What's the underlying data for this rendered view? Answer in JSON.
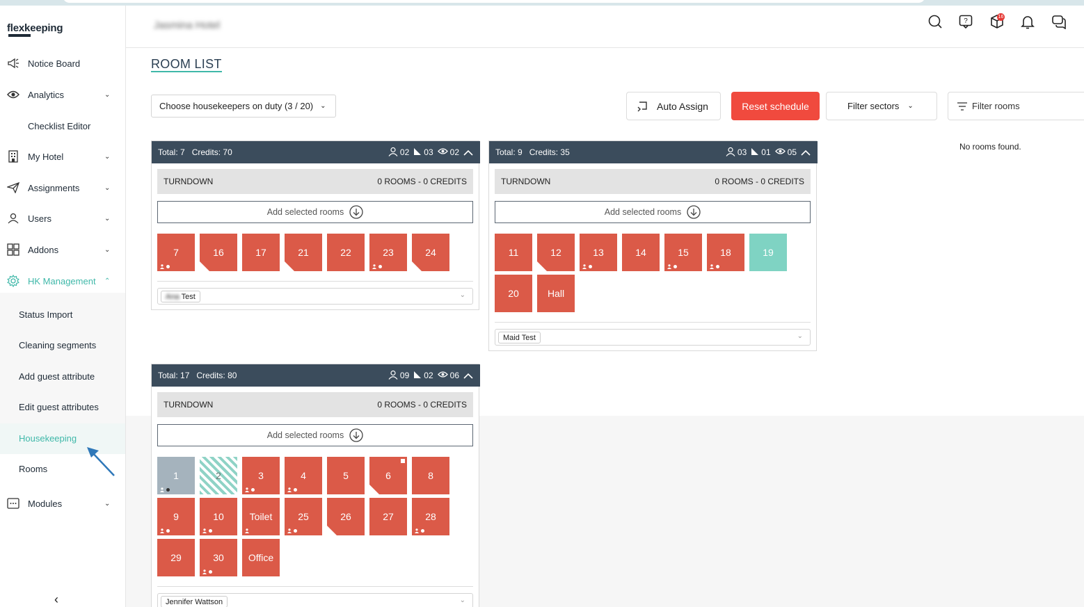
{
  "app": {
    "brand": "flexkeeping",
    "hotel_name": "Jasmina Hotel"
  },
  "sidebar": {
    "items": [
      {
        "label": "Notice Board",
        "icon": "megaphone-icon",
        "has_chevron": false
      },
      {
        "label": "Analytics",
        "icon": "eye-icon",
        "has_chevron": true
      },
      {
        "label": "Checklist Editor",
        "icon": "",
        "has_chevron": false
      },
      {
        "label": "My Hotel",
        "icon": "building-icon",
        "has_chevron": true
      },
      {
        "label": "Assignments",
        "icon": "send-icon",
        "has_chevron": true
      },
      {
        "label": "Users",
        "icon": "user-icon",
        "has_chevron": true
      },
      {
        "label": "Addons",
        "icon": "addons-icon",
        "has_chevron": true
      },
      {
        "label": "HK Management",
        "icon": "gear-icon",
        "has_chevron": true,
        "active": true
      },
      {
        "label": "Modules",
        "icon": "modules-icon",
        "has_chevron": true
      }
    ],
    "sub_items": [
      "Status Import",
      "Cleaning segments",
      "Add guest attribute",
      "Edit guest attributes",
      "Housekeeping",
      "Rooms"
    ],
    "selected_sub_item": "Housekeeping",
    "collapse_glyph": "‹"
  },
  "header": {
    "notification_count": "16",
    "icons": [
      "search-icon",
      "help-icon",
      "box-icon",
      "bell-icon",
      "chat-icon"
    ]
  },
  "main": {
    "title": "ROOM LIST",
    "housekeepers_select": "Choose housekeepers on duty (3 / 20)",
    "auto_assign": "Auto Assign",
    "reset_schedule": "Reset schedule",
    "filter_sectors": "Filter sectors",
    "filter_rooms": "Filter rooms",
    "no_rooms": "No rooms found."
  },
  "panels": [
    {
      "total": "Total: 7",
      "credits": "Credits: 70",
      "stat_users": "02",
      "stat_rooms": "03",
      "stat_views": "02",
      "turndown": "TURNDOWN",
      "turndown_count": "0 ROOMS - 0 CREDITS",
      "add_selected": "Add selected rooms",
      "assignee": "Ana Test",
      "rooms": [
        {
          "n": "7",
          "style": "red",
          "person": true,
          "dot": true
        },
        {
          "n": "16",
          "style": "red",
          "fold": true
        },
        {
          "n": "17",
          "style": "red"
        },
        {
          "n": "21",
          "style": "red",
          "fold": true
        },
        {
          "n": "22",
          "style": "red"
        },
        {
          "n": "23",
          "style": "red",
          "person": true,
          "dot": true
        },
        {
          "n": "24",
          "style": "red",
          "fold": true
        }
      ]
    },
    {
      "total": "Total: 9",
      "credits": "Credits: 35",
      "stat_users": "03",
      "stat_rooms": "01",
      "stat_views": "05",
      "turndown": "TURNDOWN",
      "turndown_count": "0 ROOMS - 0 CREDITS",
      "add_selected": "Add selected rooms",
      "assignee": "Maid Test",
      "rooms": [
        {
          "n": "11",
          "style": "red"
        },
        {
          "n": "12",
          "style": "red",
          "fold": true
        },
        {
          "n": "13",
          "style": "red",
          "person": true,
          "dot": true
        },
        {
          "n": "14",
          "style": "red"
        },
        {
          "n": "15",
          "style": "red",
          "person": true,
          "dot": true
        },
        {
          "n": "18",
          "style": "red",
          "person": true,
          "dot": true
        },
        {
          "n": "19",
          "style": "teal"
        },
        {
          "n": "20",
          "style": "red"
        },
        {
          "n": "Hall",
          "style": "red"
        }
      ]
    },
    {
      "total": "Total: 17",
      "credits": "Credits: 80",
      "stat_users": "09",
      "stat_rooms": "02",
      "stat_views": "06",
      "turndown": "TURNDOWN",
      "turndown_count": "0 ROOMS - 0 CREDITS",
      "add_selected": "Add selected rooms",
      "assignee": "Jennifer Wattson",
      "rooms": [
        {
          "n": "1",
          "style": "grey",
          "person": true,
          "dot": true
        },
        {
          "n": "2",
          "style": "striped"
        },
        {
          "n": "3",
          "style": "red",
          "person": true,
          "dot": true
        },
        {
          "n": "4",
          "style": "red",
          "person": true,
          "dot": true
        },
        {
          "n": "5",
          "style": "red"
        },
        {
          "n": "6",
          "style": "red",
          "fold": true,
          "corner": true
        },
        {
          "n": "8",
          "style": "red"
        },
        {
          "n": "9",
          "style": "red",
          "person": true,
          "dot": true
        },
        {
          "n": "10",
          "style": "red",
          "person": true,
          "dot": true
        },
        {
          "n": "Toilet",
          "style": "red",
          "person": true
        },
        {
          "n": "25",
          "style": "red",
          "person": true,
          "dot": true
        },
        {
          "n": "26",
          "style": "red",
          "fold": true
        },
        {
          "n": "27",
          "style": "red"
        },
        {
          "n": "28",
          "style": "red",
          "person": true,
          "dot": true
        },
        {
          "n": "29",
          "style": "red"
        },
        {
          "n": "30",
          "style": "red",
          "person": true,
          "dot": true
        },
        {
          "n": "Office",
          "style": "red"
        }
      ]
    }
  ],
  "colors": {
    "accent": "#3fb8a9",
    "danger": "#f04a3e",
    "room_red": "#db5a48",
    "room_teal": "#7fd3c3",
    "panel_header": "#3b4c5c"
  }
}
